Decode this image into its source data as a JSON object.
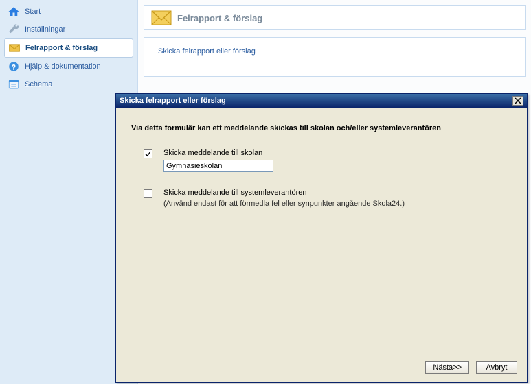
{
  "sidebar": {
    "items": [
      {
        "label": "Start"
      },
      {
        "label": "Inställningar"
      },
      {
        "label": "Felrapport & förslag"
      },
      {
        "label": "Hjälp & dokumentation"
      },
      {
        "label": "Schema"
      }
    ]
  },
  "main": {
    "panel_title": "Felrapport & förslag",
    "panel_text": "Skicka felrapport eller förslag"
  },
  "dialog": {
    "title": "Skicka felrapport eller förslag",
    "heading": "Via detta formulär kan ett meddelande skickas till skolan och/eller systemleverantören",
    "row1": {
      "label": "Skicka meddelande till skolan",
      "input_value": "Gymnasieskolan",
      "checked": true
    },
    "row2": {
      "label": "Skicka meddelande till systemleverantören",
      "note": "(Använd endast för att förmedla fel eller synpunkter angående Skola24.)",
      "checked": false
    },
    "buttons": {
      "next": "Nästa>>",
      "cancel": "Avbryt"
    }
  }
}
